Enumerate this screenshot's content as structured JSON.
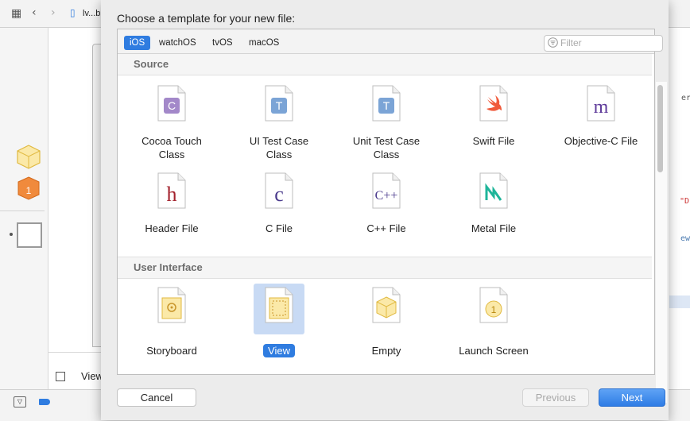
{
  "background": {
    "breadcrumb_file": "lv...b",
    "right_fragments": [
      "er",
      "\"D",
      "ew"
    ],
    "bottom_label": "View"
  },
  "dialog": {
    "title": "Choose a template for your new file:",
    "platform_tabs": [
      {
        "label": "iOS",
        "selected": true
      },
      {
        "label": "watchOS",
        "selected": false
      },
      {
        "label": "tvOS",
        "selected": false
      },
      {
        "label": "macOS",
        "selected": false
      }
    ],
    "filter_placeholder": "Filter",
    "sections": [
      {
        "title": "Source",
        "templates": [
          {
            "label": "Cocoa Touch\nClass",
            "icon": "cocoa-touch-class-icon",
            "glyph": "C"
          },
          {
            "label": "UI Test Case\nClass",
            "icon": "ui-test-case-class-icon",
            "glyph": "T"
          },
          {
            "label": "Unit Test Case\nClass",
            "icon": "unit-test-case-class-icon",
            "glyph": "T"
          },
          {
            "label": "Swift File",
            "icon": "swift-file-icon",
            "glyph": ""
          },
          {
            "label": "Objective-C File",
            "icon": "objective-c-file-icon",
            "glyph": "m"
          },
          {
            "label": "Header File",
            "icon": "header-file-icon",
            "glyph": "h"
          },
          {
            "label": "C File",
            "icon": "c-file-icon",
            "glyph": "c"
          },
          {
            "label": "C++ File",
            "icon": "cpp-file-icon",
            "glyph": "C++"
          },
          {
            "label": "Metal File",
            "icon": "metal-file-icon",
            "glyph": "M"
          }
        ]
      },
      {
        "title": "User Interface",
        "templates": [
          {
            "label": "Storyboard",
            "icon": "storyboard-icon",
            "selected": false
          },
          {
            "label": "View",
            "icon": "view-file-icon",
            "selected": true
          },
          {
            "label": "Empty",
            "icon": "empty-file-icon",
            "selected": false
          },
          {
            "label": "Launch Screen",
            "icon": "launch-screen-icon",
            "selected": false
          }
        ]
      }
    ],
    "buttons": {
      "cancel": "Cancel",
      "previous": "Previous",
      "next": "Next"
    },
    "colors": {
      "accent": "#2f7ce0",
      "selection_bg": "#c8daf4"
    }
  }
}
